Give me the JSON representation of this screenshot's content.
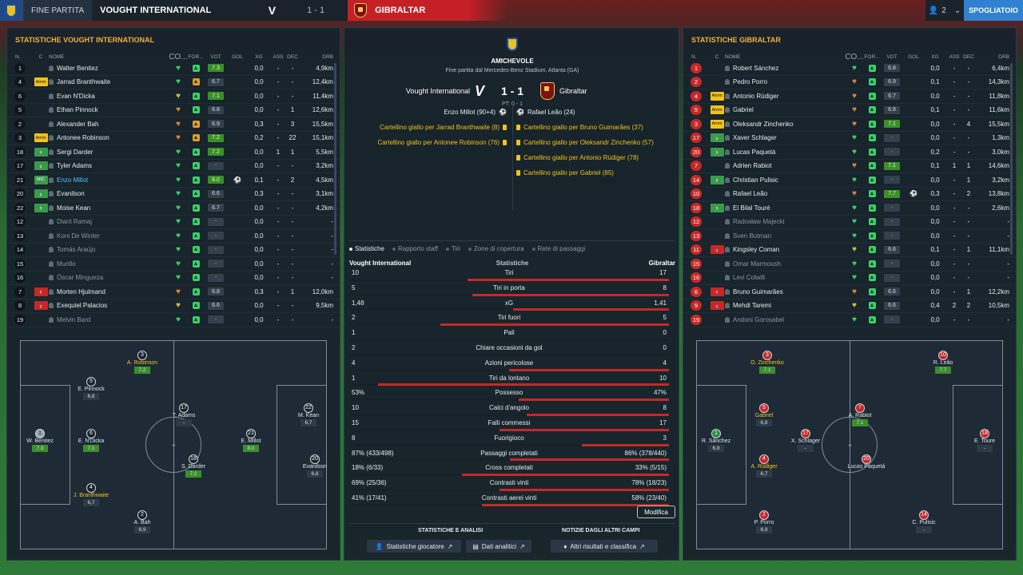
{
  "topbar": {
    "status": "Fine partita",
    "home_team": "VOUGHT INTERNATIONAL",
    "score": "1 - 1",
    "away_team": "GIBRALTAR",
    "users_count": "2",
    "dressing_room": "SPOGLIATOIO"
  },
  "left": {
    "title": "Statistiche Vought International",
    "headers": {
      "no": "N.",
      "c": "C",
      "name": "NOME",
      "co": "CO...",
      "fo": "FOR...",
      "vot": "VOT",
      "gol": "GOL",
      "xg": "XG",
      "ass": "ASS",
      "dec": "DEC",
      "drb": "DRB"
    },
    "players": [
      {
        "no": "1",
        "badge": "",
        "name": "Walter Benitez",
        "co": "g",
        "fo": "g",
        "vot": "7.3",
        "hi": true,
        "gol": "",
        "xg": "0,0",
        "ass": "-",
        "dec": "-",
        "drb": "4,9km"
      },
      {
        "no": "4",
        "badge": "Amm",
        "name": "Jarrad Branthwaite",
        "co": "g",
        "fo": "o",
        "vot": "6.7",
        "hi": false,
        "gol": "",
        "xg": "0,0",
        "ass": "-",
        "dec": "-",
        "drb": "12,4km"
      },
      {
        "no": "6",
        "badge": "",
        "name": "Evan N'Dicka",
        "co": "y",
        "fo": "g",
        "vot": "7.1",
        "hi": true,
        "gol": "",
        "xg": "0,0",
        "ass": "-",
        "dec": "-",
        "drb": "11,4km"
      },
      {
        "no": "5",
        "badge": "",
        "name": "Ethan Pinnock",
        "co": "o",
        "fo": "g",
        "vot": "6.8",
        "hi": false,
        "gol": "",
        "xg": "0,0",
        "ass": "-",
        "dec": "1",
        "drb": "12,6km"
      },
      {
        "no": "2",
        "badge": "",
        "name": "Alexander Bah",
        "co": "o",
        "fo": "o",
        "vot": "6.9",
        "hi": false,
        "gol": "",
        "xg": "0,3",
        "ass": "-",
        "dec": "3",
        "drb": "15,5km"
      },
      {
        "no": "3",
        "badge": "Amm",
        "name": "Antonee Robinson",
        "co": "o",
        "fo": "o",
        "vot": "7.2",
        "hi": true,
        "gol": "",
        "xg": "0,2",
        "ass": "-",
        "dec": "22",
        "drb": "15,1km"
      },
      {
        "no": "18",
        "badge": "in",
        "name": "Sergi Darder",
        "co": "g",
        "fo": "g",
        "vot": "7.2",
        "hi": true,
        "gol": "",
        "xg": "0,0",
        "ass": "1",
        "dec": "1",
        "drb": "5,5km"
      },
      {
        "no": "17",
        "badge": "in",
        "name": "Tyler Adams",
        "co": "g",
        "fo": "g",
        "vot": "-",
        "hi": false,
        "gol": "",
        "xg": "0,0",
        "ass": "-",
        "dec": "-",
        "drb": "3,2km"
      },
      {
        "no": "21",
        "badge": "Mic",
        "name": "Enzo Millot",
        "co": "g",
        "fo": "g",
        "vot": "8.0",
        "hi": true,
        "gol": "⚽",
        "xg": "0,1",
        "ass": "-",
        "dec": "2",
        "drb": "4,5km",
        "highlight": true
      },
      {
        "no": "20",
        "badge": "in",
        "name": "Evanilson",
        "co": "g",
        "fo": "g",
        "vot": "6.6",
        "hi": false,
        "gol": "",
        "xg": "0,3",
        "ass": "-",
        "dec": "-",
        "drb": "3,1km"
      },
      {
        "no": "22",
        "badge": "in",
        "name": "Moise Kean",
        "co": "g",
        "fo": "g",
        "vot": "6.7",
        "hi": false,
        "gol": "",
        "xg": "0,0",
        "ass": "-",
        "dec": "-",
        "drb": "4,2km"
      },
      {
        "no": "12",
        "badge": "",
        "name": "Diant Ramaj",
        "co": "g",
        "fo": "g",
        "vot": "-",
        "hi": false,
        "gol": "",
        "xg": "0,0",
        "ass": "-",
        "dec": "-",
        "drb": "-",
        "sub": true
      },
      {
        "no": "13",
        "badge": "",
        "name": "Koni De Winter",
        "co": "g",
        "fo": "g",
        "vot": "-",
        "hi": false,
        "gol": "",
        "xg": "0,0",
        "ass": "-",
        "dec": "-",
        "drb": "-",
        "sub": true
      },
      {
        "no": "14",
        "badge": "",
        "name": "Tomás Araújo",
        "co": "g",
        "fo": "g",
        "vot": "-",
        "hi": false,
        "gol": "",
        "xg": "0,0",
        "ass": "-",
        "dec": "-",
        "drb": "-",
        "sub": true
      },
      {
        "no": "15",
        "badge": "",
        "name": "Murillo",
        "co": "g",
        "fo": "g",
        "vot": "-",
        "hi": false,
        "gol": "",
        "xg": "0,0",
        "ass": "-",
        "dec": "-",
        "drb": "-",
        "sub": true
      },
      {
        "no": "16",
        "badge": "",
        "name": "Óscar Mingueza",
        "co": "g",
        "fo": "g",
        "vot": "-",
        "hi": false,
        "gol": "",
        "xg": "0,0",
        "ass": "-",
        "dec": "-",
        "drb": "-",
        "sub": true
      },
      {
        "no": "7",
        "badge": "out",
        "name": "Morten Hjulmand",
        "co": "o",
        "fo": "g",
        "vot": "6.8",
        "hi": false,
        "gol": "",
        "xg": "0,3",
        "ass": "-",
        "dec": "1",
        "drb": "12,0km"
      },
      {
        "no": "8",
        "badge": "out",
        "name": "Exequiel Palacios",
        "co": "y",
        "fo": "g",
        "vot": "6.6",
        "hi": false,
        "gol": "",
        "xg": "0,0",
        "ass": "-",
        "dec": "-",
        "drb": "9,5km"
      },
      {
        "no": "19",
        "badge": "",
        "name": "Melvin Bard",
        "co": "g",
        "fo": "g",
        "vot": "-",
        "hi": false,
        "gol": "",
        "xg": "0,0",
        "ass": "-",
        "dec": "-",
        "drb": "-",
        "sub": true
      }
    ],
    "pitch": [
      {
        "no": "3",
        "name": "A. Robinson",
        "vot": "7.2",
        "hi": true,
        "yellow": true
      },
      {
        "no": "5",
        "name": "E. Pinnock",
        "vot": "6,8",
        "hi": false,
        "yellow": false
      },
      {
        "no": "17",
        "name": "T. Adams",
        "vot": "-",
        "hi": false,
        "yellow": false
      },
      {
        "no": "22",
        "name": "M. Kean",
        "vot": "6,7",
        "hi": false,
        "yellow": false
      },
      {
        "no": "1",
        "name": "W. Benitez",
        "vot": "7.3",
        "hi": true,
        "yellow": false
      },
      {
        "no": "6",
        "name": "E. N'Dicka",
        "vot": "7.1",
        "hi": true,
        "yellow": false
      },
      {
        "no": "21",
        "name": "E. Millot",
        "vot": "8.0",
        "hi": true,
        "yellow": false
      },
      {
        "no": "18",
        "name": "S. Darder",
        "vot": "7.2",
        "hi": true,
        "yellow": false
      },
      {
        "no": "20",
        "name": "Evanilson",
        "vot": "6,6",
        "hi": false,
        "yellow": false
      },
      {
        "no": "4",
        "name": "J. Branthwaite",
        "vot": "6,7",
        "hi": false,
        "yellow": true
      },
      {
        "no": "2",
        "name": "A. Bah",
        "vot": "6,9",
        "hi": false,
        "yellow": false
      }
    ]
  },
  "right": {
    "title": "Statistiche Gibraltar",
    "players": [
      {
        "no": "1",
        "badge": "",
        "name": "Robert Sánchez",
        "co": "g",
        "fo": "g",
        "vot": "6.8",
        "hi": false,
        "gol": "",
        "xg": "0,0",
        "ass": "-",
        "dec": "-",
        "drb": "6,4km"
      },
      {
        "no": "2",
        "badge": "",
        "name": "Pedro Porro",
        "co": "o",
        "fo": "g",
        "vot": "6.9",
        "hi": false,
        "gol": "",
        "xg": "0,1",
        "ass": "-",
        "dec": "-",
        "drb": "14,3km"
      },
      {
        "no": "4",
        "badge": "Amm",
        "name": "Antonio Rüdiger",
        "co": "o",
        "fo": "g",
        "vot": "6.7",
        "hi": false,
        "gol": "",
        "xg": "0,0",
        "ass": "-",
        "dec": "-",
        "drb": "11,8km"
      },
      {
        "no": "5",
        "badge": "Amm",
        "name": "Gabriel",
        "co": "o",
        "fo": "g",
        "vot": "6.8",
        "hi": false,
        "gol": "",
        "xg": "0,1",
        "ass": "-",
        "dec": "-",
        "drb": "11,6km"
      },
      {
        "no": "3",
        "badge": "Amm",
        "name": "Oleksandr Zinchenko",
        "co": "o",
        "fo": "g",
        "vot": "7.1",
        "hi": true,
        "gol": "",
        "xg": "0,0",
        "ass": "-",
        "dec": "4",
        "drb": "15,5km"
      },
      {
        "no": "17",
        "badge": "in",
        "name": "Xaver Schlager",
        "co": "g",
        "fo": "g",
        "vot": "-",
        "hi": false,
        "gol": "",
        "xg": "0,0",
        "ass": "-",
        "dec": "-",
        "drb": "1,3km"
      },
      {
        "no": "20",
        "badge": "in",
        "name": "Lucas Paquetá",
        "co": "g",
        "fo": "g",
        "vot": "-",
        "hi": false,
        "gol": "",
        "xg": "0,2",
        "ass": "-",
        "dec": "-",
        "drb": "3,0km"
      },
      {
        "no": "7",
        "badge": "",
        "name": "Adrien Rabiot",
        "co": "o",
        "fo": "g",
        "vot": "7.1",
        "hi": true,
        "gol": "",
        "xg": "0,1",
        "ass": "1",
        "dec": "1",
        "drb": "14,6km"
      },
      {
        "no": "14",
        "badge": "in",
        "name": "Christian Pulisic",
        "co": "g",
        "fo": "g",
        "vot": "-",
        "hi": false,
        "gol": "",
        "xg": "0,0",
        "ass": "-",
        "dec": "1",
        "drb": "3,2km"
      },
      {
        "no": "10",
        "badge": "",
        "name": "Rafael Leão",
        "co": "o",
        "fo": "g",
        "vot": "7.7",
        "hi": true,
        "gol": "⚽",
        "xg": "0,3",
        "ass": "-",
        "dec": "2",
        "drb": "13,8km"
      },
      {
        "no": "18",
        "badge": "in",
        "name": "El Bilal Touré",
        "co": "g",
        "fo": "g",
        "vot": "-",
        "hi": false,
        "gol": "",
        "xg": "0,0",
        "ass": "-",
        "dec": "-",
        "drb": "2,6km"
      },
      {
        "no": "12",
        "badge": "",
        "name": "Radosław Majecki",
        "co": "g",
        "fo": "g",
        "vot": "-",
        "hi": false,
        "gol": "",
        "xg": "0,0",
        "ass": "-",
        "dec": "-",
        "drb": "-",
        "sub": true
      },
      {
        "no": "13",
        "badge": "",
        "name": "Sven Botman",
        "co": "g",
        "fo": "g",
        "vot": "-",
        "hi": false,
        "gol": "",
        "xg": "0,0",
        "ass": "-",
        "dec": "-",
        "drb": "-",
        "sub": true
      },
      {
        "no": "11",
        "badge": "out",
        "name": "Kingsley Coman",
        "co": "y",
        "fo": "g",
        "vot": "6.6",
        "hi": false,
        "gol": "",
        "xg": "0,1",
        "ass": "-",
        "dec": "1",
        "drb": "11,1km"
      },
      {
        "no": "15",
        "badge": "",
        "name": "Omar Marmoush",
        "co": "g",
        "fo": "g",
        "vot": "-",
        "hi": false,
        "gol": "",
        "xg": "0,0",
        "ass": "-",
        "dec": "-",
        "drb": "-",
        "sub": true
      },
      {
        "no": "16",
        "badge": "",
        "name": "Levi Colwill",
        "co": "g",
        "fo": "g",
        "vot": "-",
        "hi": false,
        "gol": "",
        "xg": "0,0",
        "ass": "-",
        "dec": "-",
        "drb": "-",
        "sub": true
      },
      {
        "no": "6",
        "badge": "out",
        "name": "Bruno Guimarães",
        "co": "o",
        "fo": "g",
        "vot": "6.6",
        "hi": false,
        "gol": "",
        "xg": "0,0",
        "ass": "-",
        "dec": "1",
        "drb": "12,2km"
      },
      {
        "no": "9",
        "badge": "out",
        "name": "Mehdi Taremi",
        "co": "y",
        "fo": "g",
        "vot": "6.6",
        "hi": false,
        "gol": "",
        "xg": "0,4",
        "ass": "2",
        "dec": "2",
        "drb": "10,5km"
      },
      {
        "no": "19",
        "badge": "",
        "name": "Andoni Gorosabel",
        "co": "g",
        "fo": "g",
        "vot": "-",
        "hi": false,
        "gol": "",
        "xg": "0,0",
        "ass": "-",
        "dec": "-",
        "drb": "-",
        "sub": true
      }
    ],
    "pitch": [
      {
        "no": "3",
        "name": "O. Zinchenko",
        "vot": "7.1",
        "hi": true,
        "yellow": true
      },
      {
        "no": "10",
        "name": "R. Leão",
        "vot": "7.7",
        "hi": true,
        "yellow": false
      },
      {
        "no": "5",
        "name": "Gabriel",
        "vot": "6,8",
        "hi": false,
        "yellow": true
      },
      {
        "no": "7",
        "name": "A. Rabiot",
        "vot": "7.1",
        "hi": true,
        "yellow": false
      },
      {
        "no": "1",
        "name": "R. Sánchez",
        "vot": "6,8",
        "hi": false,
        "yellow": false
      },
      {
        "no": "17",
        "name": "X. Schlager",
        "vot": "-",
        "hi": false,
        "yellow": false
      },
      {
        "no": "18",
        "name": "E. Toure",
        "vot": "-",
        "hi": false,
        "yellow": false
      },
      {
        "no": "4",
        "name": "A. Rüdiger",
        "vot": "6,7",
        "hi": false,
        "yellow": true
      },
      {
        "no": "20",
        "name": "Lucas Paquetá",
        "vot": "",
        "hi": false,
        "yellow": false
      },
      {
        "no": "2",
        "name": "P. Porro",
        "vot": "6,9",
        "hi": false,
        "yellow": false
      },
      {
        "no": "14",
        "name": "C. Pulisic",
        "vot": "-",
        "hi": false,
        "yellow": false
      }
    ]
  },
  "match": {
    "type": "Amichevole",
    "subtitle": "Fine partita dal Mercedes-Benz Stadium, Atlanta (GA)",
    "home": "Vought International",
    "away": "Gibraltar",
    "score": "1 - 1",
    "pt": "PT: 0 - 1",
    "home_events": [
      {
        "text": "Enzo Millot (90+4)",
        "kind": "goal"
      },
      {
        "text": "Cartellino giallo per Jarrad Branthwaite (8)",
        "kind": "card"
      },
      {
        "text": "Cartellino giallo per Antonee Robinson (76)",
        "kind": "card"
      }
    ],
    "away_events": [
      {
        "text": "Rafael Leão (24)",
        "kind": "goal"
      },
      {
        "text": "Cartellino giallo per Bruno Guimarães (37)",
        "kind": "card"
      },
      {
        "text": "Cartellino giallo per Oleksandr Zinchenko (57)",
        "kind": "card"
      },
      {
        "text": "Cartellino giallo per Antonio Rüdiger (78)",
        "kind": "card"
      },
      {
        "text": "Cartellino giallo per Gabriel (85)",
        "kind": "card"
      }
    ],
    "tabs": [
      "Statistiche",
      "Rapporto staff",
      "Tiri",
      "Zone di copertura",
      "Rete di passaggi"
    ],
    "stats_head": {
      "home": "Vought International",
      "center": "Statistiche",
      "away": "Gibraltar"
    },
    "stats": [
      {
        "label": "Tiri",
        "home": "10",
        "away": "17",
        "hv": 10,
        "av": 17
      },
      {
        "label": "Tiri in porta",
        "home": "5",
        "away": "8",
        "hv": 5,
        "av": 8
      },
      {
        "label": "xG",
        "home": "1,48",
        "away": "1,41",
        "hv": 1.48,
        "av": 1.41
      },
      {
        "label": "Tiri fuori",
        "home": "2",
        "away": "5",
        "hv": 2,
        "av": 5
      },
      {
        "label": "Pali",
        "home": "1",
        "away": "0",
        "hv": 1,
        "av": 0
      },
      {
        "label": "Chiare occasioni da gol",
        "home": "2",
        "away": "0",
        "hv": 2,
        "av": 0
      },
      {
        "label": "Azioni pericolose",
        "home": "4",
        "away": "4",
        "hv": 4,
        "av": 4
      },
      {
        "label": "Tiri da lontano",
        "home": "1",
        "away": "10",
        "hv": 1,
        "av": 10
      },
      {
        "label": "Possesso",
        "home": "53%",
        "away": "47%",
        "hv": 53,
        "av": 47
      },
      {
        "label": "Calci d'angolo",
        "home": "10",
        "away": "8",
        "hv": 10,
        "av": 8
      },
      {
        "label": "Falli commessi",
        "home": "15",
        "away": "17",
        "hv": 15,
        "av": 17
      },
      {
        "label": "Fuorigioco",
        "home": "8",
        "away": "3",
        "hv": 8,
        "av": 3
      },
      {
        "label": "Passaggi completati",
        "home": "87% (433/498)",
        "away": "86% (378/440)",
        "hv": 87,
        "av": 86
      },
      {
        "label": "Cross completati",
        "home": "18% (6/33)",
        "away": "33% (5/15)",
        "hv": 18,
        "av": 33
      },
      {
        "label": "Contrasti vinti",
        "home": "69% (25/36)",
        "away": "78% (18/23)",
        "hv": 69,
        "av": 78
      },
      {
        "label": "Contrasti aerei vinti",
        "home": "41% (17/41)",
        "away": "58% (23/40)",
        "hv": 41,
        "av": 58
      }
    ],
    "modifica": "Modifica",
    "foot_left_title": "Statistiche e analisi",
    "foot_right_title": "Notizie dagli altri campi",
    "btn_player_stats": "Statistiche giocatore",
    "btn_analytics": "Dati analitici",
    "btn_other_results": "Altri risultati e classifica"
  }
}
